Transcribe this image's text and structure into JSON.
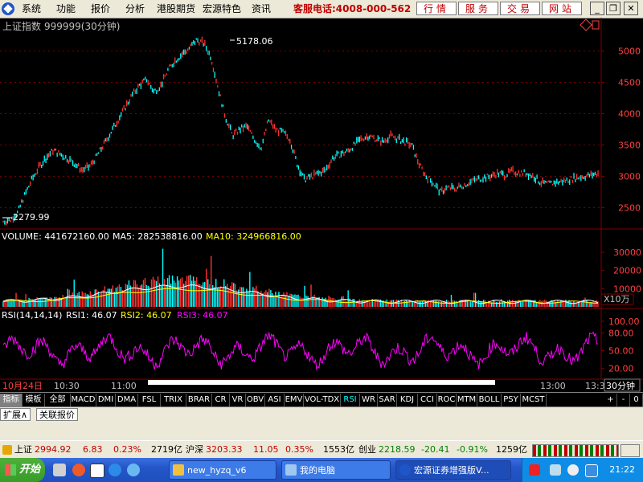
{
  "menubar": {
    "items": [
      "系统",
      "功能",
      "报价",
      "分析",
      "港股期货",
      "宏源特色",
      "资讯"
    ],
    "hotline": "客服电话:4008-000-562",
    "buttons": [
      "行情",
      "服务",
      "交易",
      "网站"
    ],
    "window_controls": [
      "_",
      "restore",
      "x"
    ]
  },
  "chart": {
    "title": "上证指数",
    "code": "999999(30分钟)",
    "high_label": "5178.06",
    "low_label": "2279.99",
    "price_axis": [
      "5000",
      "4500",
      "4000",
      "3500",
      "3000",
      "2500"
    ],
    "volume_header": {
      "label": "VOLUME: 441672160.00",
      "ma5": "MA5: 282538816.00",
      "ma10": "MA10: 324966816.00"
    },
    "volume_axis": [
      "30000",
      "20000",
      "10000"
    ],
    "volume_unit": "X10万",
    "rsi_header": {
      "label": "RSI(14,14,14)",
      "rsi1": "RSI1: 46.07",
      "rsi2": "RSI2: 46.07",
      "rsi3": "RSI3: 46.07"
    },
    "rsi_axis": [
      "100.00",
      "80.00",
      "50.00",
      "20.00"
    ],
    "time_labels": [
      "10月24日",
      "10:30",
      "11:00",
      "13:00",
      "13:3"
    ],
    "period": "30分钟",
    "colors": {
      "up": "#ff3030",
      "down": "#00ffff",
      "ma5": "#ffffff",
      "ma10": "#ffff00",
      "rsi": "#ff00ff",
      "grid": "#800000"
    }
  },
  "chart_data": {
    "type": "line",
    "title": "上证指数 999999(30分钟)",
    "annotations": [
      "5178.06",
      "2279.99"
    ],
    "price_path": [
      2280,
      2310,
      2420,
      2700,
      2950,
      3150,
      3300,
      3420,
      3350,
      3280,
      3200,
      3100,
      3150,
      3320,
      3500,
      3700,
      3900,
      4100,
      4300,
      4450,
      4550,
      4350,
      4450,
      4700,
      4850,
      4950,
      5050,
      5178,
      5120,
      4900,
      4400,
      3950,
      3650,
      3750,
      3800,
      3600,
      3450,
      3900,
      3750,
      3700,
      3600,
      3200,
      2950,
      3000,
      3050,
      3100,
      3300,
      3350,
      3400,
      3500,
      3600,
      3650,
      3600,
      3550,
      3650,
      3600,
      3550,
      3500,
      3200,
      3000,
      2900,
      2750,
      2820,
      2800,
      2850,
      2900,
      2950,
      2980,
      3000,
      3050,
      3020,
      3080,
      3060,
      3050,
      3000,
      2900,
      2880,
      2900,
      2920,
      2950,
      2980,
      3000,
      3020,
      3050
    ],
    "ylim": [
      2200,
      5300
    ],
    "rsi_range": [
      0,
      100
    ]
  },
  "tabs": [
    "指标",
    "模板",
    "全部",
    "MACD",
    "DMI",
    "DMA",
    "FSL",
    "TRIX",
    "BRAR",
    "CR",
    "VR",
    "OBV",
    "ASI",
    "EMV",
    "VOL-TDX",
    "RSI",
    "WR",
    "SAR",
    "KDJ",
    "CCI",
    "ROC",
    "MTM",
    "BOLL",
    "PSY",
    "MCST"
  ],
  "tabs_right": [
    "+",
    "-",
    "0"
  ],
  "tabs2": [
    "扩展∧",
    "关联报价"
  ],
  "ticker": {
    "sh_label": "上证",
    "sh_val": "2994.92",
    "sh_chg": "6.83",
    "sh_pct": "0.23%",
    "sh_amt": "2719亿",
    "hs_label": "沪深",
    "hs_val": "3203.33",
    "hs_chg": "11.05",
    "hs_pct": "0.35%",
    "hs_amt": "1553亿",
    "cy_label": "创业",
    "cy_val": "2218.59",
    "cy_chg": "-20.41",
    "cy_pct": "-0.91%",
    "cy_amt": "1259亿"
  },
  "taskbar": {
    "start": "开始",
    "tasks": [
      "new_hyzq_v6",
      "我的电脑",
      "宏源证券增强版V..."
    ],
    "clock": "21:22"
  }
}
